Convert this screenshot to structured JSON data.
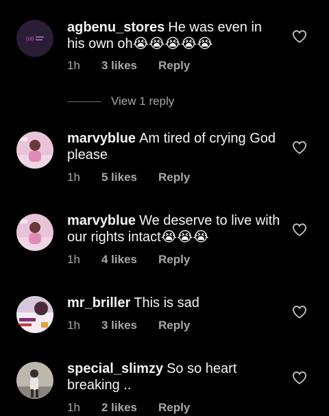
{
  "comments": [
    {
      "username": "agbenu_stores",
      "text": "He was even in his own oh",
      "emojis": "😭😭😭😭😭",
      "time": "1h",
      "likes": "3 likes",
      "reply": "Reply"
    },
    {
      "username": "marvyblue",
      "text": "Am tired of crying God please",
      "emojis": "",
      "time": "1h",
      "likes": "5 likes",
      "reply": "Reply"
    },
    {
      "username": "marvyblue",
      "text": "We deserve to live with our rights intact",
      "emojis": "😭😭😭",
      "time": "1h",
      "likes": "4 likes",
      "reply": "Reply"
    },
    {
      "username": "mr_briller",
      "text": "This is sad",
      "emojis": "",
      "time": "1h",
      "likes": "3 likes",
      "reply": "Reply"
    },
    {
      "username": "special_slimzy",
      "text": "So so heart breaking ..",
      "emojis": "",
      "time": "1h",
      "likes": "2 likes",
      "reply": "Reply"
    }
  ],
  "view_replies": "View 1 reply",
  "icons": {
    "like": "heart-outline-icon"
  },
  "colors": {
    "background": "#000000",
    "primary_text": "#f5f5f5",
    "secondary_text": "#a8a8a8"
  }
}
